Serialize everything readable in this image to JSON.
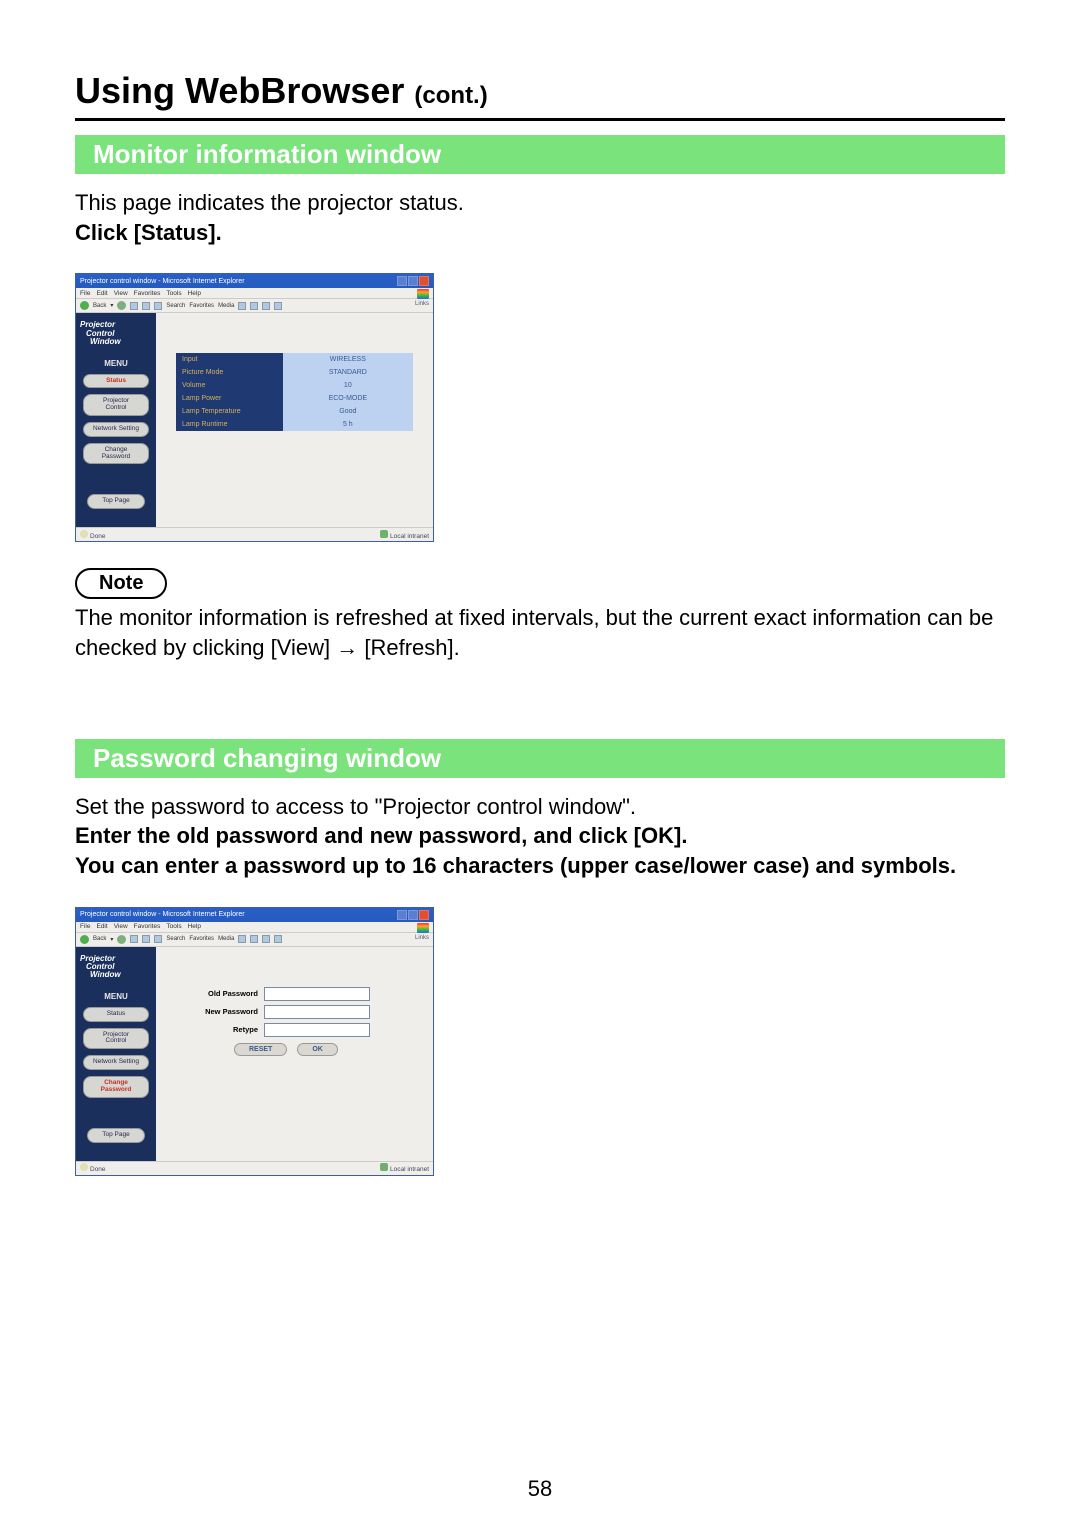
{
  "page_title_main": "Using WebBrowser ",
  "page_title_cont": "(cont.)",
  "section1_title": "Monitor information window",
  "section1_p1": "This page indicates the projector status.",
  "section1_p2": "Click [Status].",
  "section2_title": "Password changing window",
  "section2_p1": "Set the password to access to \"Projector control window\".",
  "section2_p2": "Enter the old password and new password, and click [OK].",
  "section2_p3": "You can enter a password up to 16 characters (upper case/lower case) and symbols.",
  "note_label": "Note",
  "note_text": "The monitor information is refreshed at fixed intervals, but the current exact information can be checked by clicking [View] → [Refresh].",
  "page_number": "58",
  "ie": {
    "title": "Projector control window - Microsoft Internet Explorer",
    "menus": [
      "File",
      "Edit",
      "View",
      "Favorites",
      "Tools",
      "Help"
    ],
    "tb_back": "Back",
    "tb_search": "Search",
    "tb_favorites": "Favorites",
    "tb_media": "Media",
    "tb_links": "Links",
    "status_done": "Done",
    "status_zone": "Local intranet"
  },
  "sidebar": {
    "logo1": "Projector",
    "logo2": "Control",
    "logo3": "Window",
    "menu": "MENU",
    "status": "Status",
    "projector_control": "Projector\nControl",
    "network_setting": "Network Setting",
    "change_password": "Change\nPassword",
    "top_page": "Top Page"
  },
  "status_rows": [
    {
      "k": "Input",
      "v": "WIRELESS"
    },
    {
      "k": "Picture Mode",
      "v": "STANDARD"
    },
    {
      "k": "Volume",
      "v": "10"
    },
    {
      "k": "Lamp Power",
      "v": "ECO-MODE"
    },
    {
      "k": "Lamp Temperature",
      "v": "Good"
    },
    {
      "k": "Lamp Runtime",
      "v": "5 h"
    }
  ],
  "pw": {
    "old": "Old Password",
    "new": "New Password",
    "retype": "Retype",
    "reset": "RESET",
    "ok": "OK"
  }
}
